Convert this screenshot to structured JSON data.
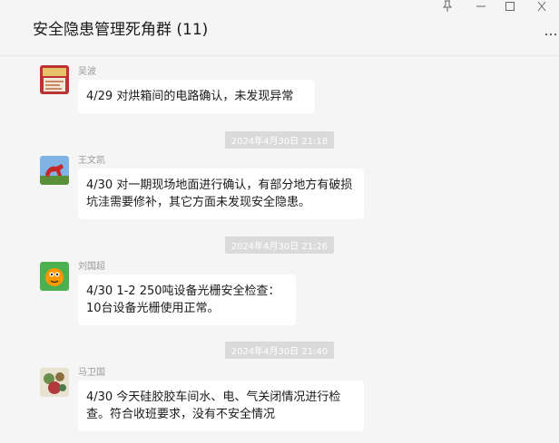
{
  "window": {
    "title": "安全隐患管理死角群 (11)",
    "pin_icon": "pin-icon",
    "minimize_icon": "minimize-icon",
    "maximize_icon": "maximize-icon",
    "close_icon": "close-icon",
    "more_icon": "more-icon"
  },
  "messages": [
    {
      "sender": "吴波",
      "text": "4/29 对烘箱间的电路确认，未发现异常"
    },
    {
      "sender": "王文凯",
      "text": "4/30 对一期现场地面进行确认，有部分地方有破损坑洼需要修补，其它方面未发现安全隐患。"
    },
    {
      "sender": "刘国超",
      "text": "4/30 1-2 250吨设备光栅安全检查：10台设备光栅使用正常。"
    },
    {
      "sender": "马卫国",
      "text": "4/30 今天硅胶胶车间水、电、气关闭情况进行检查。符合收班要求，没有不安全情况"
    }
  ],
  "timestamps": [
    "2024年4月30日 21:18",
    "2024年4月30日 21:26",
    "2024年4月30日 21:40"
  ]
}
